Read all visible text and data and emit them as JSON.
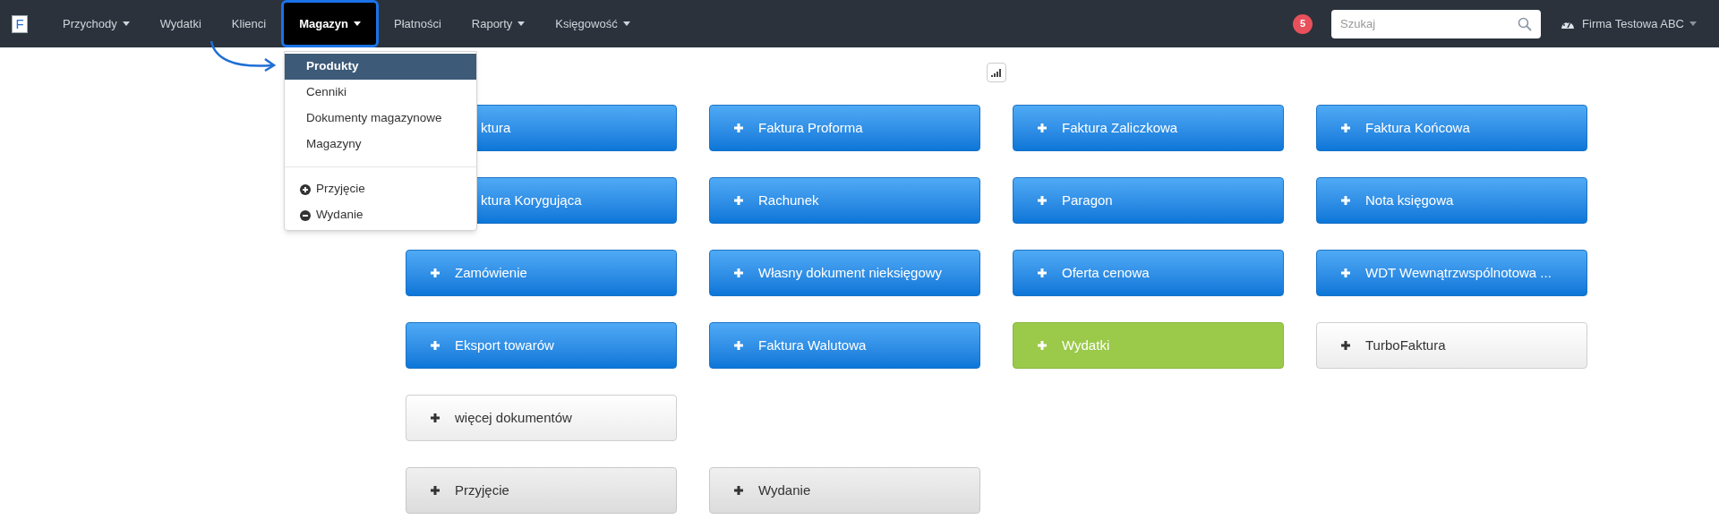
{
  "navbar": {
    "logo": "F",
    "items": [
      {
        "label": "Przychody",
        "dropdown": true,
        "selected": false
      },
      {
        "label": "Wydatki",
        "dropdown": false,
        "selected": false
      },
      {
        "label": "Klienci",
        "dropdown": false,
        "selected": false
      },
      {
        "label": "Magazyn",
        "dropdown": true,
        "selected": true
      },
      {
        "label": "Płatności",
        "dropdown": false,
        "selected": false
      },
      {
        "label": "Raporty",
        "dropdown": true,
        "selected": false
      },
      {
        "label": "Księgowość",
        "dropdown": true,
        "selected": false
      }
    ],
    "notification_count": "5",
    "search": {
      "placeholder": "Szukaj"
    },
    "company": "Firma Testowa ABC"
  },
  "dropdown_menu": {
    "items": [
      {
        "label": "Produkty",
        "kind": "link",
        "selected": true
      },
      {
        "label": "Cenniki",
        "kind": "link",
        "selected": false
      },
      {
        "label": "Dokumenty magazynowe",
        "kind": "link",
        "selected": false
      },
      {
        "label": "Magazyny",
        "kind": "link",
        "selected": false
      },
      {
        "kind": "divider"
      },
      {
        "label": "Przyjęcie",
        "kind": "plus",
        "selected": false
      },
      {
        "label": "Wydanie",
        "kind": "minus",
        "selected": false
      }
    ]
  },
  "button_groups": [
    {
      "buttons": [
        {
          "label": "ktura",
          "kind": "blue",
          "covered": true
        },
        {
          "label": "Faktura Proforma",
          "kind": "blue",
          "covered": false
        },
        {
          "label": "Faktura Zaliczkowa",
          "kind": "blue",
          "covered": false
        },
        {
          "label": "Faktura Końcowa",
          "kind": "blue",
          "covered": false
        },
        {
          "label": "ktura Korygująca",
          "kind": "blue",
          "covered": true
        },
        {
          "label": "Rachunek",
          "kind": "blue",
          "covered": false
        },
        {
          "label": "Paragon",
          "kind": "blue",
          "covered": false
        },
        {
          "label": "Nota księgowa",
          "kind": "blue",
          "covered": false
        },
        {
          "label": "Zamówienie",
          "kind": "blue",
          "covered": false
        },
        {
          "label": "Własny dokument nieksięgowy",
          "kind": "blue",
          "covered": false
        },
        {
          "label": "Oferta cenowa",
          "kind": "blue",
          "covered": false
        },
        {
          "label": "WDT Wewnątrzwspólnotowa ...",
          "kind": "blue",
          "covered": false
        },
        {
          "label": "Eksport towarów",
          "kind": "blue",
          "covered": false
        },
        {
          "label": "Faktura Walutowa",
          "kind": "blue",
          "covered": false
        },
        {
          "label": "Wydatki",
          "kind": "green",
          "covered": false
        },
        {
          "label": "TurboFaktura",
          "kind": "white",
          "covered": false
        }
      ]
    },
    {
      "buttons": [
        {
          "label": "więcej dokumentów",
          "kind": "white",
          "covered": false
        }
      ]
    },
    {
      "buttons": [
        {
          "label": "Przyjęcie",
          "kind": "grey",
          "covered": false
        },
        {
          "label": "Wydanie",
          "kind": "grey",
          "covered": false
        }
      ]
    }
  ]
}
